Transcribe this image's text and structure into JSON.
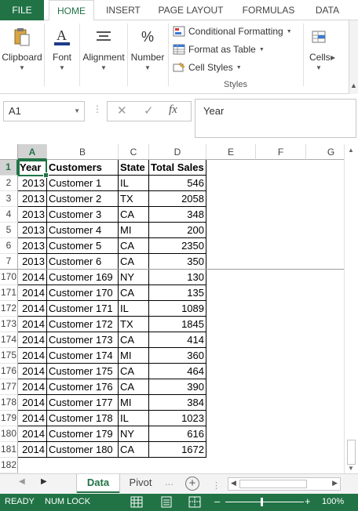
{
  "ribbon_tabs": {
    "file": "FILE",
    "home": "HOME",
    "insert": "INSERT",
    "page_layout": "PAGE LAYOUT",
    "formulas": "FORMULAS",
    "data": "DATA"
  },
  "ribbon": {
    "clipboard": "Clipboard",
    "font": "Font",
    "alignment": "Alignment",
    "number": "Number",
    "number_icon": "%",
    "conditional_formatting": "Conditional Formatting",
    "format_as_table": "Format as Table",
    "cell_styles": "Cell Styles",
    "styles_group": "Styles",
    "cells": "Cells"
  },
  "formula_bar": {
    "name_box": "A1",
    "content": "Year",
    "fx": "fx"
  },
  "columns": [
    "A",
    "B",
    "C",
    "D",
    "E",
    "F",
    "G"
  ],
  "header_row": {
    "row": "1",
    "year": "Year",
    "customers": "Customers",
    "state": "State",
    "sales": "Total Sales"
  },
  "rows": [
    {
      "row": "2",
      "year": "2013",
      "customer": "Customer 1",
      "state": "IL",
      "sales": "546"
    },
    {
      "row": "3",
      "year": "2013",
      "customer": "Customer 2",
      "state": "TX",
      "sales": "2058"
    },
    {
      "row": "4",
      "year": "2013",
      "customer": "Customer 3",
      "state": "CA",
      "sales": "348"
    },
    {
      "row": "5",
      "year": "2013",
      "customer": "Customer 4",
      "state": "MI",
      "sales": "200"
    },
    {
      "row": "6",
      "year": "2013",
      "customer": "Customer 5",
      "state": "CA",
      "sales": "2350"
    },
    {
      "row": "7",
      "year": "2013",
      "customer": "Customer 6",
      "state": "CA",
      "sales": "350"
    },
    {
      "row": "170",
      "year": "2014",
      "customer": "Customer 169",
      "state": "NY",
      "sales": "130"
    },
    {
      "row": "171",
      "year": "2014",
      "customer": "Customer 170",
      "state": "CA",
      "sales": "135"
    },
    {
      "row": "172",
      "year": "2014",
      "customer": "Customer 171",
      "state": "IL",
      "sales": "1089"
    },
    {
      "row": "173",
      "year": "2014",
      "customer": "Customer 172",
      "state": "TX",
      "sales": "1845"
    },
    {
      "row": "174",
      "year": "2014",
      "customer": "Customer 173",
      "state": "CA",
      "sales": "414"
    },
    {
      "row": "175",
      "year": "2014",
      "customer": "Customer 174",
      "state": "MI",
      "sales": "360"
    },
    {
      "row": "176",
      "year": "2014",
      "customer": "Customer 175",
      "state": "CA",
      "sales": "464"
    },
    {
      "row": "177",
      "year": "2014",
      "customer": "Customer 176",
      "state": "CA",
      "sales": "390"
    },
    {
      "row": "178",
      "year": "2014",
      "customer": "Customer 177",
      "state": "MI",
      "sales": "384"
    },
    {
      "row": "179",
      "year": "2014",
      "customer": "Customer 178",
      "state": "IL",
      "sales": "1023"
    },
    {
      "row": "180",
      "year": "2014",
      "customer": "Customer 179",
      "state": "NY",
      "sales": "616"
    },
    {
      "row": "181",
      "year": "2014",
      "customer": "Customer 180",
      "state": "CA",
      "sales": "1672"
    }
  ],
  "last_row": "182",
  "sheets": {
    "active": "Data",
    "other": "Pivot",
    "ellipsis": "..."
  },
  "status": {
    "ready": "READY",
    "num_lock": "NUM LOCK",
    "zoom_minus": "–",
    "zoom_plus": "+",
    "zoom": "100%"
  },
  "colors": {
    "accent": "#217346",
    "header_selected": "#d2d2d2"
  },
  "icons": [
    "paste-icon",
    "font-icon",
    "align-icon",
    "percent-icon",
    "conditional-formatting-icon",
    "format-table-icon",
    "cell-styles-icon",
    "cells-icon",
    "normal-view-icon",
    "page-layout-view-icon",
    "page-break-view-icon",
    "add-sheet-icon"
  ]
}
